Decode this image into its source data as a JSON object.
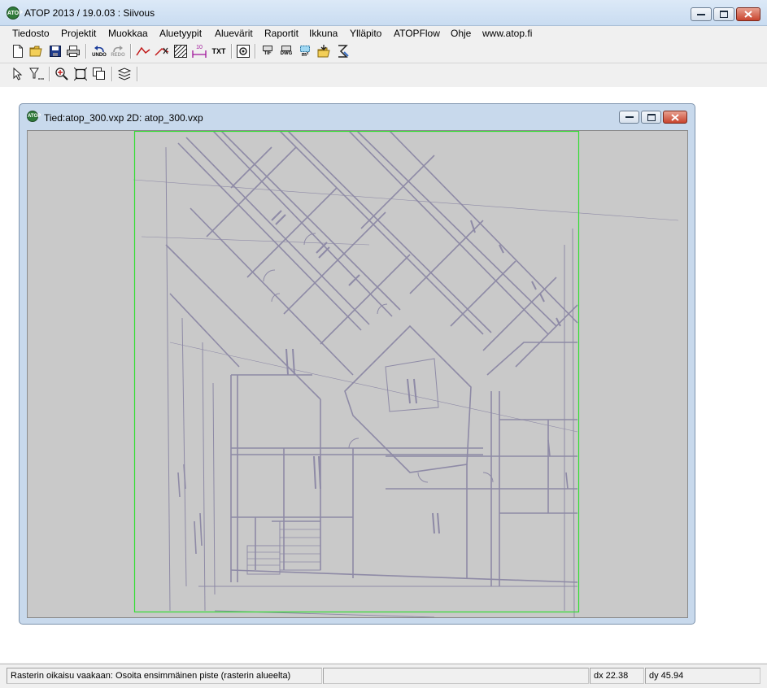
{
  "app": {
    "title": "ATOP 2013 / 19.0.03 : Siivous",
    "logo_text": "ATOP"
  },
  "menu": {
    "items": [
      "Tiedosto",
      "Projektit",
      "Muokkaa",
      "Aluetyypit",
      "Aluevärit",
      "Raportit",
      "Ikkuna",
      "Ylläpito",
      "ATOPFlow",
      "Ohje",
      "www.atop.fi"
    ]
  },
  "toolbar1": {
    "undo_label": "UNDO",
    "redo_label": "REDO",
    "dim_label": "10",
    "txt_label": "TXT",
    "tif_label": "TIF",
    "dwg_label": "DWG",
    "area_label": "m²",
    "icons": [
      "new-file-icon",
      "open-folder-icon",
      "save-icon",
      "print-icon",
      "undo-icon",
      "redo-icon",
      "polyline-icon",
      "delete-line-icon",
      "hatch-icon",
      "dimension-icon",
      "text-icon",
      "snapshot-icon",
      "tif-icon",
      "dwg-icon",
      "area-icon",
      "import-icon",
      "wizard-icon"
    ]
  },
  "toolbar2": {
    "icons": [
      "select-arrow-icon",
      "filter-icon",
      "zoom-in-icon",
      "zoom-extents-icon",
      "window-copy-icon",
      "layers-icon"
    ]
  },
  "child_window": {
    "title": "Tied:atop_300.vxp 2D: atop_300.vxp"
  },
  "colors": {
    "drawing_line": "#8e8aa6",
    "frame": "#33dd33",
    "canvas": "#c9c9c9"
  },
  "status": {
    "message": "Rasterin oikaisu vaakaan: Osoita ensimmäinen piste (rasterin alueelta)",
    "dx": "dx 22.38",
    "dy": "dy 45.94"
  }
}
